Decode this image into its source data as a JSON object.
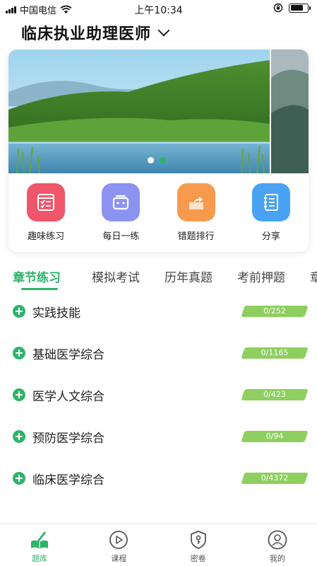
{
  "status_bar": {
    "carrier": "中国电信",
    "time": "上午10:34",
    "battery_level": 0.75
  },
  "header": {
    "title": "临床执业助理医师",
    "dropdown_icon": "chevron-down-icon"
  },
  "banner": {
    "active_index": 1,
    "slide_count": 2
  },
  "shortcuts": [
    {
      "label": "趣味练习",
      "icon": "quiz-list-icon",
      "color": "#f0566a"
    },
    {
      "label": "每日一练",
      "icon": "daily-box-icon",
      "color": "#8c92f0"
    },
    {
      "label": "错题排行",
      "icon": "share-box-icon",
      "color": "#f79a4e"
    },
    {
      "label": "分享",
      "icon": "notebook-icon",
      "color": "#4aa2f5"
    }
  ],
  "tabs": [
    {
      "label": "章节练习",
      "active": true
    },
    {
      "label": "模拟考试",
      "active": false
    },
    {
      "label": "历年真题",
      "active": false
    },
    {
      "label": "考前押题",
      "active": false
    },
    {
      "label": "章",
      "active": false
    }
  ],
  "chapters": [
    {
      "name": "实践技能",
      "progress": "0/252"
    },
    {
      "name": "基础医学综合",
      "progress": "0/1165"
    },
    {
      "name": "医学人文综合",
      "progress": "0/423"
    },
    {
      "name": "预防医学综合",
      "progress": "0/94"
    },
    {
      "name": "临床医学综合",
      "progress": "0/4372"
    }
  ],
  "bottom_nav": [
    {
      "label": "题库",
      "icon": "book-pen-icon",
      "active": true
    },
    {
      "label": "课程",
      "icon": "play-circle-icon",
      "active": false
    },
    {
      "label": "密卷",
      "icon": "shield-key-icon",
      "active": false
    },
    {
      "label": "我的",
      "icon": "user-circle-icon",
      "active": false
    }
  ],
  "colors": {
    "accent": "#2fb36b",
    "progress_bar": "#8ecf5f"
  }
}
